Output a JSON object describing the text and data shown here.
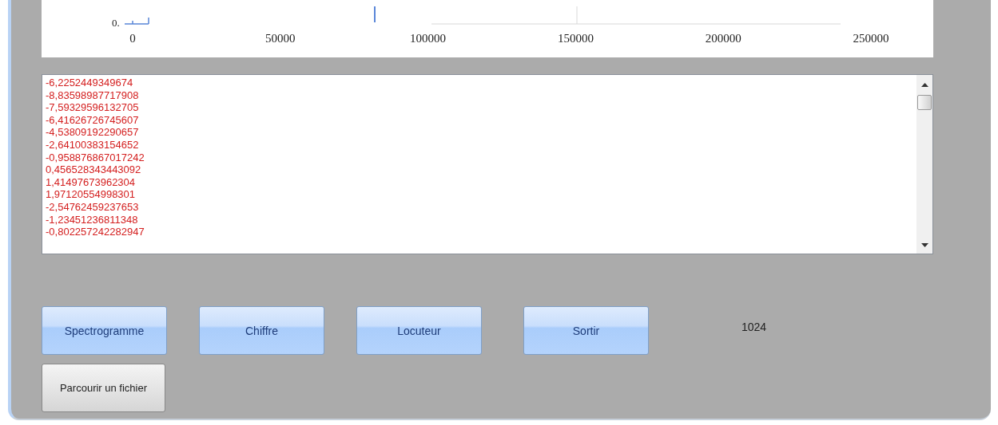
{
  "chart": {
    "y_tick_label": "0.",
    "x_ticks": [
      "0",
      "50000",
      "100000",
      "150000",
      "200000",
      "250000"
    ]
  },
  "output_lines": [
    "-6,2252449349674",
    "-8,83598987717908",
    "-7,59329596132705",
    "-6,41626726745607",
    "-4,53809192290657",
    "-2,64100383154652",
    "-0,958876867017242",
    "0,456528343443092",
    "1,41497673962304",
    "1,97120554998301",
    "-2,54762459237653",
    "-1,23451236811348",
    "-0,802257242282947"
  ],
  "buttons": [
    {
      "label": "Spectrogramme",
      "kind": "primary"
    },
    {
      "label": "Chiffre",
      "kind": "primary"
    },
    {
      "label": "Locuteur",
      "kind": "primary"
    },
    {
      "label": "Sortir",
      "kind": "primary"
    }
  ],
  "value_label": "1024",
  "browse_button": {
    "label": "Parcourir un fichier",
    "kind": "secondary"
  }
}
